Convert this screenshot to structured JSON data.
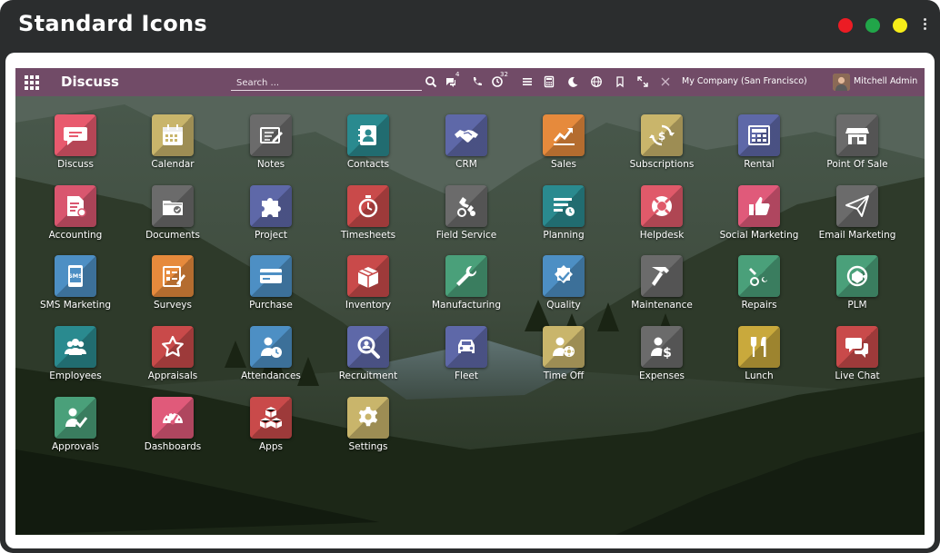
{
  "window": {
    "title": "Standard Icons",
    "controls": {
      "close_color": "#ec1c24",
      "maximize_color": "#21a649",
      "minimize_color": "#f7ed19"
    }
  },
  "navbar": {
    "app_name": "Discuss",
    "search_placeholder": "Search ...",
    "messages_badge": "4",
    "activity_badge": "32",
    "company": "My Company (San Francisco)",
    "user": "Mitchell Admin",
    "bg_color": "#714b67"
  },
  "apps": [
    {
      "label": "Discuss",
      "icon": "chat-bubble-icon",
      "color": "#e85a6e"
    },
    {
      "label": "Calendar",
      "icon": "calendar-icon",
      "color": "#c9b56b"
    },
    {
      "label": "Notes",
      "icon": "notes-icon",
      "color": "#6b6b6b"
    },
    {
      "label": "Contacts",
      "icon": "contacts-icon",
      "color": "#2a8a8f"
    },
    {
      "label": "CRM",
      "icon": "handshake-icon",
      "color": "#5e68a8"
    },
    {
      "label": "Sales",
      "icon": "chart-up-icon",
      "color": "#e68a3c"
    },
    {
      "label": "Subscriptions",
      "icon": "subscription-icon",
      "color": "#c9b56b"
    },
    {
      "label": "Rental",
      "icon": "rental-icon",
      "color": "#5e68a8"
    },
    {
      "label": "Point Of Sale",
      "icon": "store-icon",
      "color": "#6b6b6b"
    },
    {
      "label": "Accounting",
      "icon": "accounting-icon",
      "color": "#d9566f"
    },
    {
      "label": "Documents",
      "icon": "documents-icon",
      "color": "#6b6b6b"
    },
    {
      "label": "Project",
      "icon": "puzzle-icon",
      "color": "#5e68a8"
    },
    {
      "label": "Timesheets",
      "icon": "stopwatch-icon",
      "color": "#c94a4a"
    },
    {
      "label": "Field Service",
      "icon": "field-service-icon",
      "color": "#6b6b6b"
    },
    {
      "label": "Planning",
      "icon": "planning-icon",
      "color": "#2a8a8f"
    },
    {
      "label": "Helpdesk",
      "icon": "lifebuoy-icon",
      "color": "#e05a6a"
    },
    {
      "label": "Social Marketing",
      "icon": "thumbs-up-icon",
      "color": "#e05a7a"
    },
    {
      "label": "Email Marketing",
      "icon": "paper-plane-icon",
      "color": "#6b6b6b"
    },
    {
      "label": "SMS Marketing",
      "icon": "sms-icon",
      "color": "#4d8fc4"
    },
    {
      "label": "Surveys",
      "icon": "surveys-icon",
      "color": "#e68a3c"
    },
    {
      "label": "Purchase",
      "icon": "credit-card-icon",
      "color": "#4d8fc4"
    },
    {
      "label": "Inventory",
      "icon": "box-icon",
      "color": "#c94a4a"
    },
    {
      "label": "Manufacturing",
      "icon": "wrench-icon",
      "color": "#4aa07a"
    },
    {
      "label": "Quality",
      "icon": "quality-icon",
      "color": "#4d8fc4"
    },
    {
      "label": "Maintenance",
      "icon": "hammer-icon",
      "color": "#6b6b6b"
    },
    {
      "label": "Repairs",
      "icon": "repairs-icon",
      "color": "#4aa07a"
    },
    {
      "label": "PLM",
      "icon": "plm-icon",
      "color": "#4aa07a"
    },
    {
      "label": "Employees",
      "icon": "employees-icon",
      "color": "#2a8a8f"
    },
    {
      "label": "Appraisals",
      "icon": "star-icon",
      "color": "#c94a4a"
    },
    {
      "label": "Attendances",
      "icon": "attendance-icon",
      "color": "#4d8fc4"
    },
    {
      "label": "Recruitment",
      "icon": "magnifier-icon",
      "color": "#5e68a8"
    },
    {
      "label": "Fleet",
      "icon": "car-icon",
      "color": "#5e68a8"
    },
    {
      "label": "Time Off",
      "icon": "time-off-icon",
      "color": "#c9b56b"
    },
    {
      "label": "Expenses",
      "icon": "expenses-icon",
      "color": "#6b6b6b"
    },
    {
      "label": "Lunch",
      "icon": "lunch-icon",
      "color": "#c9a93c"
    },
    {
      "label": "Live Chat",
      "icon": "live-chat-icon",
      "color": "#c94a4a"
    },
    {
      "label": "Approvals",
      "icon": "approvals-icon",
      "color": "#4aa07a"
    },
    {
      "label": "Dashboards",
      "icon": "gauge-icon",
      "color": "#e05a7a"
    },
    {
      "label": "Apps",
      "icon": "cubes-icon",
      "color": "#c94a4a"
    },
    {
      "label": "Settings",
      "icon": "gear-icon",
      "color": "#c9b56b"
    }
  ]
}
